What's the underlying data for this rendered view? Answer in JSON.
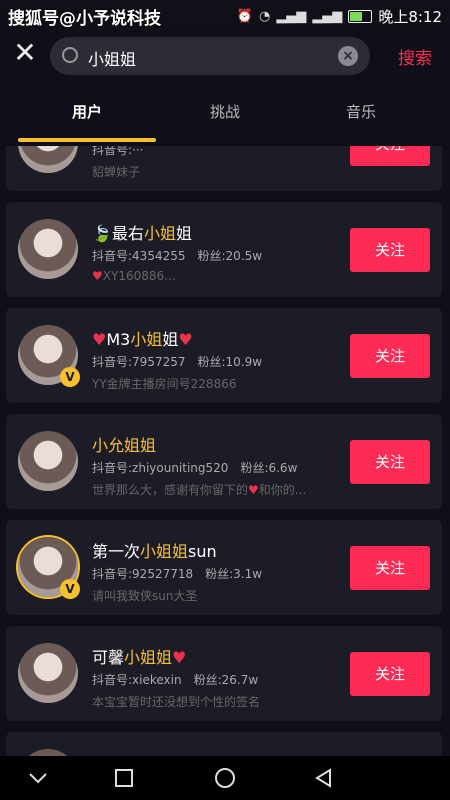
{
  "status": {
    "watermark": "搜狐号@小予说科技",
    "time": "晚上8:12"
  },
  "search": {
    "query": "小姐姐",
    "button": "搜索"
  },
  "tabs": [
    {
      "label": "用户"
    },
    {
      "label": "挑战"
    },
    {
      "label": "音乐"
    }
  ],
  "users": [
    {
      "id_line": "抖音号:···",
      "fans": "",
      "desc": "貂蝉妹子"
    },
    {
      "prefix": "最右",
      "hl": "小姐",
      "suffix": "姐",
      "id_line": "抖音号:4354255",
      "fans": "粉丝:20.5w",
      "desc": "XY160886..."
    },
    {
      "prefix": "M3",
      "hl": "小姐",
      "suffix": "姐",
      "id_line": "抖音号:7957257",
      "fans": "粉丝:10.9w",
      "desc": "YY金牌主播房间号228866"
    },
    {
      "prefix": "小允",
      "hl": "姐姐",
      "suffix": "",
      "id_line": "抖音号:zhiyouniting520",
      "fans": "粉丝:6.6w",
      "desc": "世界那么大，感谢有你留下的",
      "desc2": "和你的..."
    },
    {
      "prefix": "第一次",
      "hl": "小姐姐",
      "suffix": "sun",
      "id_line": "抖音号:92527718",
      "fans": "粉丝:3.1w",
      "desc": "请叫我致侠sun大圣"
    },
    {
      "prefix": "可馨",
      "hl": "小姐姐",
      "suffix": "",
      "id_line": "抖音号:xiekexin",
      "fans": "粉丝:26.7w",
      "desc": "本宝宝暂时还没想到个性的签名"
    }
  ],
  "follow_label": "关注",
  "icons": {
    "close": "close-icon",
    "search": "search-icon",
    "clear": "clear-icon",
    "back": "back-icon",
    "home": "home-icon",
    "recent": "recent-icon",
    "collapse": "chevron-down-icon"
  }
}
